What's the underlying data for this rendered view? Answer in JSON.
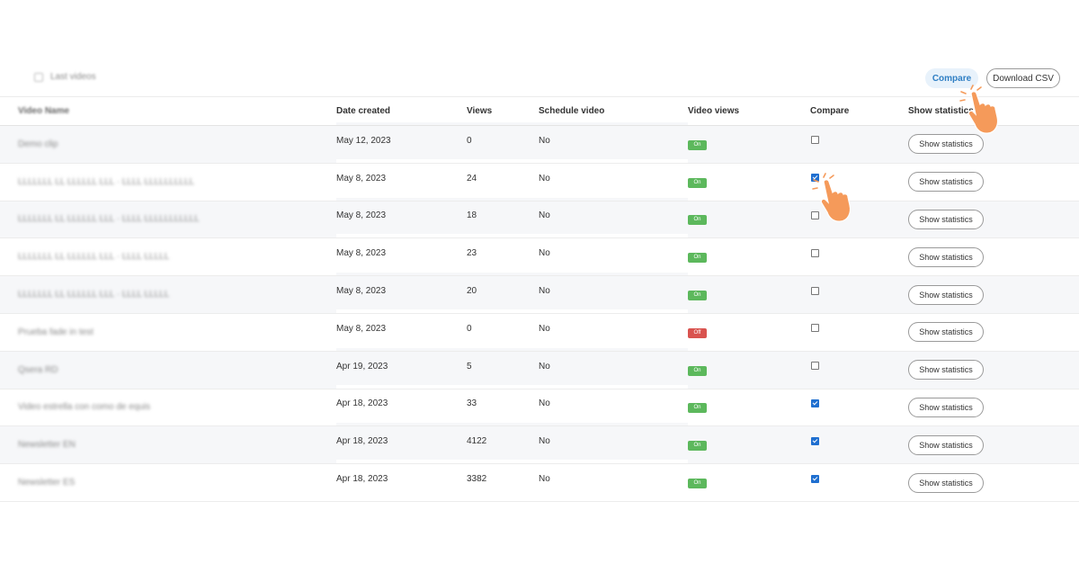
{
  "toolbar": {
    "list_label": "Last videos",
    "compare_label": "Compare",
    "download_label": "Download CSV"
  },
  "table": {
    "columns": {
      "name": "Video Name",
      "date": "Date created",
      "views": "Views",
      "schedule": "Schedule video",
      "video_views": "Video views",
      "compare": "Compare",
      "stats": "Show statistics"
    },
    "rows": [
      {
        "name": "Demo clip",
        "date": "May 12, 2023",
        "views": "0",
        "schedule": "No",
        "status": "On",
        "compare": false,
        "stats": "Show statistics"
      },
      {
        "name": "LLLLLLL LL LLLLLL LLL · LLLL LLLLLLLLLL",
        "date": "May 8, 2023",
        "views": "24",
        "schedule": "No",
        "status": "On",
        "compare": true,
        "stats": "Show statistics"
      },
      {
        "name": "LLLLLLL LL LLLLLL LLL · LLLL LLLLLLLLLLL",
        "date": "May 8, 2023",
        "views": "18",
        "schedule": "No",
        "status": "On",
        "compare": false,
        "stats": "Show statistics"
      },
      {
        "name": "LLLLLLL LL LLLLLL LLL · LLLL LLLLL",
        "date": "May 8, 2023",
        "views": "23",
        "schedule": "No",
        "status": "On",
        "compare": false,
        "stats": "Show statistics"
      },
      {
        "name": "LLLLLLL LL LLLLLL LLL · LLLL LLLLL",
        "date": "May 8, 2023",
        "views": "20",
        "schedule": "No",
        "status": "On",
        "compare": false,
        "stats": "Show statistics"
      },
      {
        "name": "Prueba fade in test",
        "date": "May 8, 2023",
        "views": "0",
        "schedule": "No",
        "status": "Off",
        "compare": false,
        "stats": "Show statistics"
      },
      {
        "name": "Qsera RD",
        "date": "Apr 19, 2023",
        "views": "5",
        "schedule": "No",
        "status": "On",
        "compare": false,
        "stats": "Show statistics"
      },
      {
        "name": "Video estrella con como de equis",
        "date": "Apr 18, 2023",
        "views": "33",
        "schedule": "No",
        "status": "On",
        "compare": true,
        "stats": "Show statistics"
      },
      {
        "name": "Newsletter EN",
        "date": "Apr 18, 2023",
        "views": "4122",
        "schedule": "No",
        "status": "On",
        "compare": true,
        "stats": "Show statistics"
      },
      {
        "name": "Newsletter ES",
        "date": "Apr 18, 2023",
        "views": "3382",
        "schedule": "No",
        "status": "On",
        "compare": true,
        "stats": "Show statistics"
      }
    ]
  },
  "colors": {
    "accent": "#2f7fc4",
    "on": "#5cb85c",
    "off": "#d9534f",
    "hand": "#f59a5a"
  },
  "icons": {
    "pointer": "pointing-hand-icon"
  }
}
